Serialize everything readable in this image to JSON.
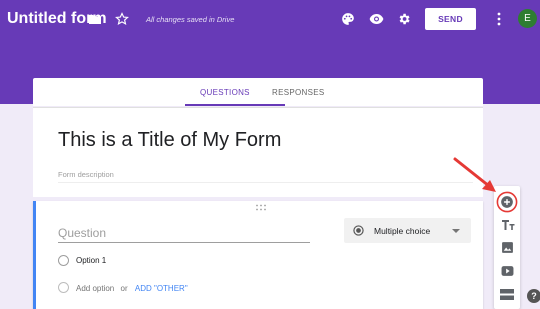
{
  "header": {
    "app_title": "Untitled form",
    "save_status": "All changes saved in Drive",
    "send_label": "SEND",
    "avatar_initial": "E"
  },
  "tabs": [
    {
      "label": "QUESTIONS",
      "active": true
    },
    {
      "label": "RESPONSES",
      "active": false
    }
  ],
  "form": {
    "title": "This is a Title of My Form",
    "description_placeholder": "Form description"
  },
  "question": {
    "placeholder": "Question",
    "type": "Multiple choice",
    "options": [
      "Option 1"
    ],
    "add_option_label": "Add option",
    "or_label": "or",
    "add_other_label": "ADD \"OTHER\""
  },
  "sidebar_tools": [
    "add-question-icon",
    "add-title-icon",
    "add-image-icon",
    "add-video-icon",
    "add-section-icon"
  ],
  "help_label": "?",
  "colors": {
    "brand": "#673ab7",
    "accent_blue": "#4285f4",
    "annotation_red": "#e53935"
  }
}
